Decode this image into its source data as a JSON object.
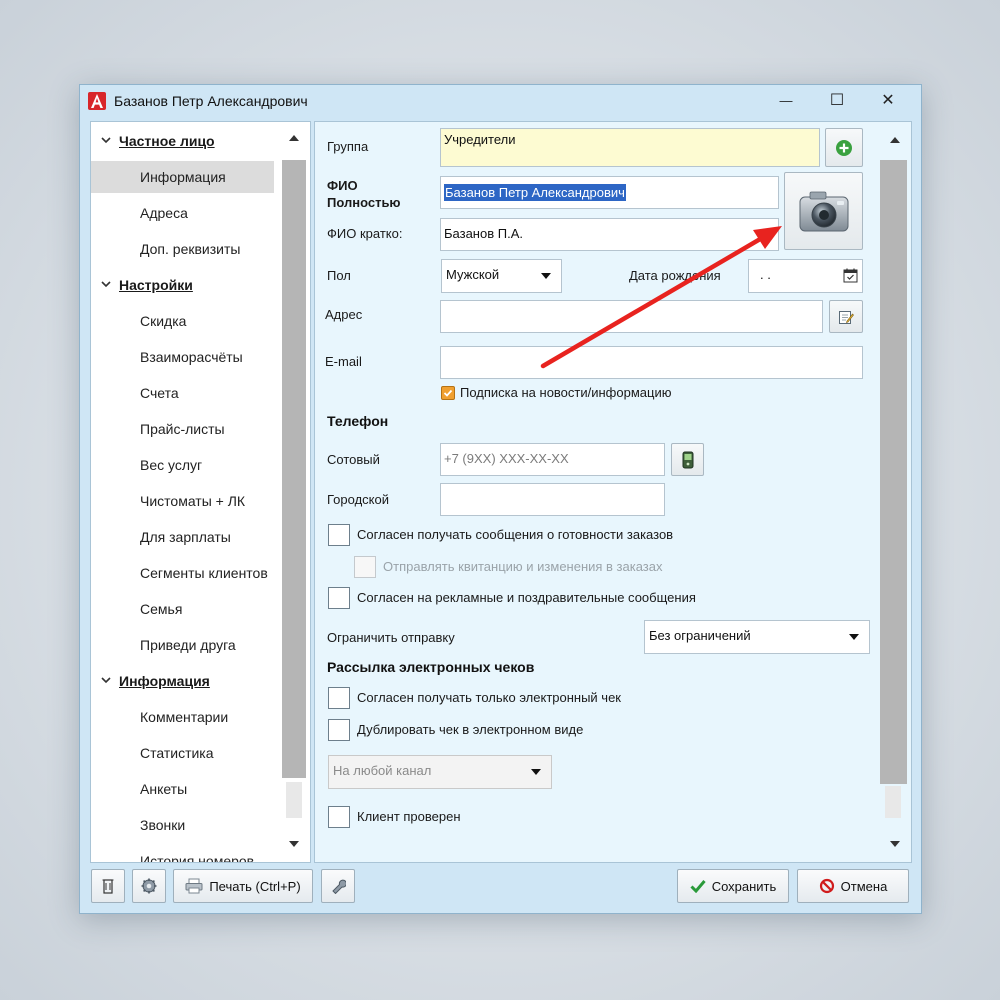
{
  "window": {
    "title": "Базанов Петр Александрович",
    "minimize": "—",
    "maximize": "☐",
    "close": "✕"
  },
  "nav": {
    "sections": [
      {
        "label": "Частное лицо",
        "items": [
          "Информация",
          "Адреса",
          "Доп. реквизиты"
        ]
      },
      {
        "label": "Настройки",
        "items": [
          "Скидка",
          "Взаиморасчёты",
          "Счета",
          "Прайс-листы",
          "Вес услуг",
          "Чистоматы + ЛК",
          "Для зарплаты",
          "Сегменты клиентов",
          "Семья",
          "Приведи друга"
        ]
      },
      {
        "label": "Информация",
        "items": [
          "Комментарии",
          "Статистика",
          "Анкеты",
          "Звонки",
          "История номеров"
        ]
      }
    ],
    "selected": "Информация"
  },
  "form": {
    "group_label": "Группа",
    "group_value": "Учредители",
    "fio_full_label_1": "ФИО",
    "fio_full_label_2": "Полностью",
    "fio_full_value": "Базанов Петр Александрович",
    "fio_short_label": "ФИО кратко:",
    "fio_short_value": "Базанов П.А.",
    "gender_label": "Пол",
    "gender_value": "Мужской",
    "birth_label": "Дата рождения",
    "birth_value": ". .",
    "address_label": "Адрес",
    "address_value": "",
    "email_label": "E-mail",
    "email_value": "",
    "subscribe_label": "Подписка на новости/информацию",
    "subscribe_checked": true,
    "phone_header": "Телефон",
    "mobile_label": "Сотовый",
    "mobile_placeholder": "+7 (9XX) XXX-XX-XX",
    "landline_label": "Городской",
    "landline_value": "",
    "agree_ready_label": "Согласен получать сообщения о готовности заказов",
    "send_receipt_label": "Отправлять квитанцию и изменения в заказах",
    "agree_ads_label": "Согласен на рекламные и поздравительные сообщения",
    "limit_label": "Ограничить отправку",
    "limit_value": "Без ограничений",
    "receipts_header": "Рассылка электронных чеков",
    "only_electronic_label": "Согласен получать только электронный чек",
    "duplicate_label": "Дублировать чек в электронном виде",
    "channel_value": "На любой канал",
    "verified_label": "Клиент проверен"
  },
  "toolbar": {
    "print_label": "Печать (Ctrl+P)",
    "save_label": "Сохранить",
    "cancel_label": "Отмена"
  },
  "colors": {
    "window_bg": "#cfe6f5",
    "form_bg": "#e8f6fd",
    "group_field_bg": "#fdfbd2",
    "selection": "#2d66c5",
    "annotation_arrow": "#e8231f",
    "save_check": "#2a9a3a",
    "cancel_icon": "#d01c1c"
  }
}
